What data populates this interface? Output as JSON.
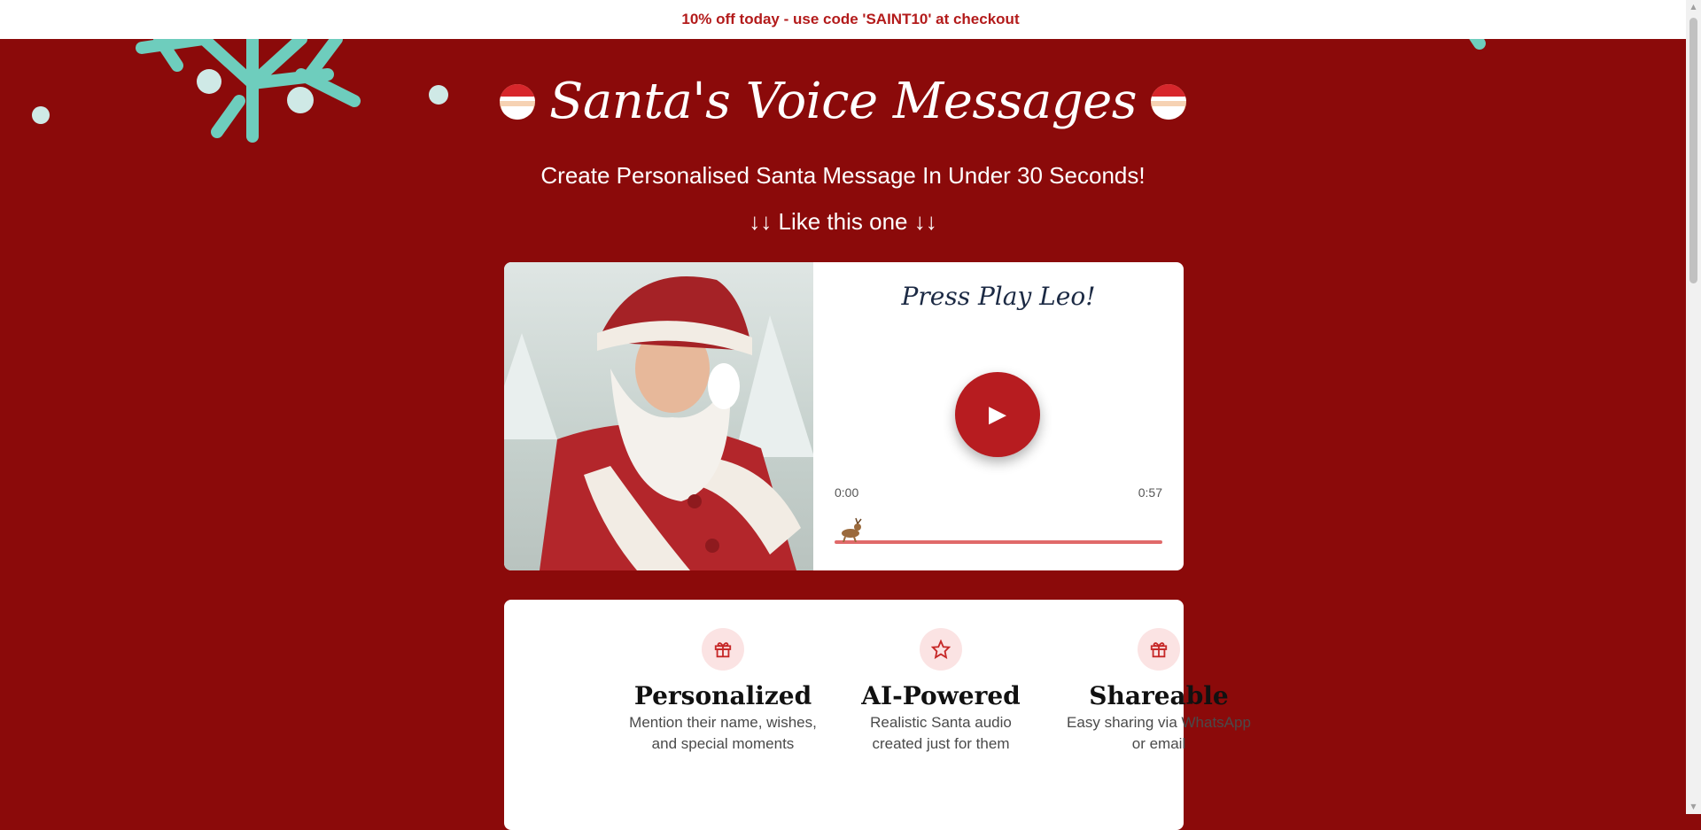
{
  "promo": {
    "text": "10% off today - use code 'SAINT10' at checkout"
  },
  "header": {
    "title": "Santa's Voice Messages",
    "subtitle": "Create Personalised Santa Message In Under 30 Seconds!",
    "example_line": "↓↓ Like this one ↓↓"
  },
  "player": {
    "heading": "Press Play Leo!",
    "current_time": "0:00",
    "total_time": "0:57",
    "progress_fraction": 0
  },
  "features": [
    {
      "icon": "gift-icon",
      "title": "Personalized",
      "description": "Mention their name, wishes, and special moments"
    },
    {
      "icon": "star-icon",
      "title": "AI-Powered",
      "description": "Realistic Santa audio created just for them"
    },
    {
      "icon": "gift-icon",
      "title": "Shareable",
      "description": "Easy sharing via WhatsApp or email"
    }
  ],
  "colors": {
    "background": "#8b0a0a",
    "accent": "#b71c20",
    "snowflake": "#6ecdbd",
    "promo_text": "#b31b1b"
  }
}
